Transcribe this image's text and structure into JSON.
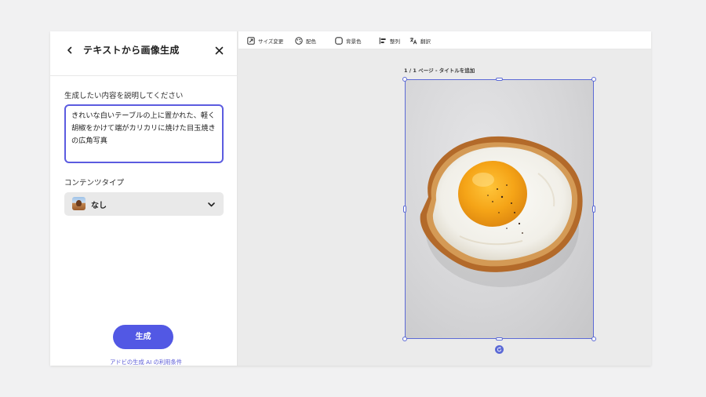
{
  "panel": {
    "title": "テキストから画像生成",
    "back_icon": "chevron-left-icon",
    "close_icon": "close-icon",
    "prompt_label": "生成したい内容を説明してください",
    "prompt_value": "きれいな白いテーブルの上に置かれた、軽く胡椒をかけて端がカリカリに焼けた目玉焼きの広角写真",
    "content_type_label": "コンテンツタイプ",
    "content_type_value": "なし",
    "generate_label": "生成",
    "terms_link": "アドビの生成 AI の利用条件"
  },
  "toolbar": {
    "items": [
      {
        "label": "サイズ変更",
        "icon": "resize-icon"
      },
      {
        "label": "配色",
        "icon": "palette-icon"
      },
      {
        "label": "背景色",
        "icon": "background-color-icon"
      },
      {
        "label": "整列",
        "icon": "align-icon"
      },
      {
        "label": "翻訳",
        "icon": "translate-icon"
      }
    ]
  },
  "canvas": {
    "page_label": "1 / 1 ページ - タイトルを追加"
  },
  "colors": {
    "accent": "#5258e4",
    "selection": "#5c6ad6"
  }
}
